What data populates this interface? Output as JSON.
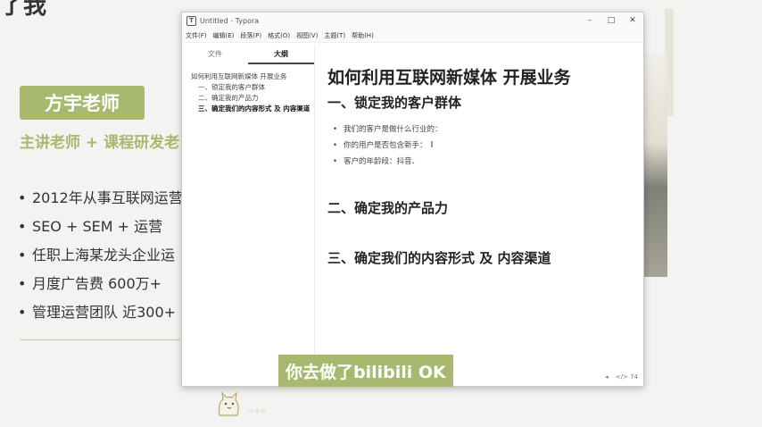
{
  "slide": {
    "heading": "了我",
    "badge": "方宇老师",
    "subtitle": "主讲老师 + 课程研发老",
    "bullets": [
      "2012年从事互联网运营",
      "SEO + SEM + 运营",
      "任职上海某龙头企业运",
      "月度广告费 600万+",
      "管理运营团队 近300+"
    ]
  },
  "window": {
    "title": "Untitled - Typora",
    "app_icon": "T",
    "controls": {
      "minimize": "–",
      "maximize": "□",
      "close": "✕"
    },
    "menu": [
      "文件(F)",
      "编辑(E)",
      "段落(P)",
      "格式(O)",
      "视图(V)",
      "主题(T)",
      "帮助(H)"
    ],
    "sidebar": {
      "tabs": [
        "文件",
        "大纲"
      ],
      "active_tab": "大纲",
      "outline": {
        "root": "如何利用互联网新媒体 开展业务",
        "items": [
          "一、锁定我的客户群体",
          "二、确定我的产品力",
          "三、确定我们的内容形式 及 内容渠道"
        ]
      }
    },
    "document": {
      "title": "如何利用互联网新媒体 开展业务",
      "section1": {
        "heading": "一、锁定我的客户群体",
        "items": [
          "我们的客户是做什么行业的：",
          "你的用户是否包含新手：",
          "客户的年龄段：抖音、"
        ]
      },
      "section2": {
        "heading": "二、确定我的产品力"
      },
      "section3": {
        "heading": "三、确定我们的内容形式 及 内容渠道"
      }
    },
    "status": {
      "outline_toggle": "◂",
      "words": "</> 74"
    }
  },
  "caption": "你去做了bilibili OK",
  "brand": {
    "accent": "#a9b86f"
  }
}
